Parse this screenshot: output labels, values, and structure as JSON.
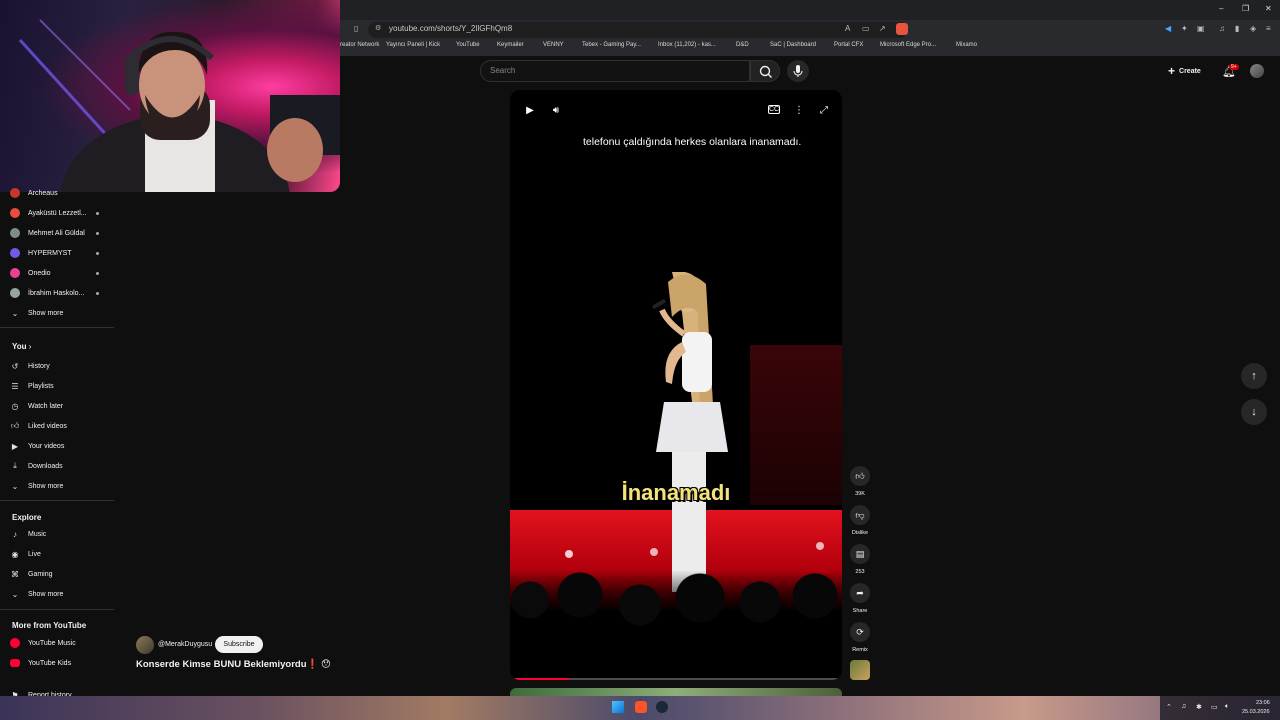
{
  "browser": {
    "url": "youtube.com/shorts/Y_2IlGFhQm8",
    "bookmarks": [
      "reator Network",
      "Yayıncı Paneli | Kick",
      "YouTube",
      "Keymailer",
      "VENNY",
      "Tebex - Gaming Pay...",
      "Inbox (11,202) - kas...",
      "D&D",
      "SaC | Dashboard",
      "Portal CFX",
      "Microsoft Edge Pro...",
      "Mixamo"
    ]
  },
  "topbar": {
    "search_placeholder": "Search",
    "create_label": "Create",
    "notification_badge": "9+"
  },
  "sidebar": {
    "subscriptions": [
      {
        "label": "Archeaus",
        "color": "#c0392b"
      },
      {
        "label": "Ayaküstü Lezzetl...",
        "color": "#e74c3c"
      },
      {
        "label": "Mehmet Ali Güldal",
        "color": "#7f8c8d"
      },
      {
        "label": "HYPERMYST",
        "color": "#6c5ce7"
      },
      {
        "label": "Onedio",
        "color": "#e84393"
      },
      {
        "label": "İbrahim Haskolo...",
        "color": "#95a5a6"
      }
    ],
    "subs_show_more": "Show more",
    "you_title": "You",
    "you_items": [
      "History",
      "Playlists",
      "Watch later",
      "Liked videos",
      "Your videos",
      "Downloads"
    ],
    "you_show_more": "Show more",
    "explore_title": "Explore",
    "explore_items": [
      "Music",
      "Live",
      "Gaming"
    ],
    "explore_show_more": "Show more",
    "more_title": "More from YouTube",
    "more_items": [
      "YouTube Music",
      "YouTube Kids"
    ],
    "report_history": "Report history"
  },
  "video": {
    "caption_top": "telefonu çaldığında herkes olanlara inanamadı.",
    "caption_main": "İnanamadı",
    "progress": 0.17
  },
  "actions": {
    "likes": "39K",
    "dislike_label": "Dislike",
    "comments": "253",
    "share_label": "Share",
    "remix_label": "Remix"
  },
  "channel": {
    "name": "@MerakDuygusu",
    "subscribe_label": "Subscribe",
    "title": "Konserde Kimse BUNU Beklemiyordu❗ 😯"
  },
  "taskbar": {
    "time": "23:06",
    "date": "25.03.2026"
  }
}
